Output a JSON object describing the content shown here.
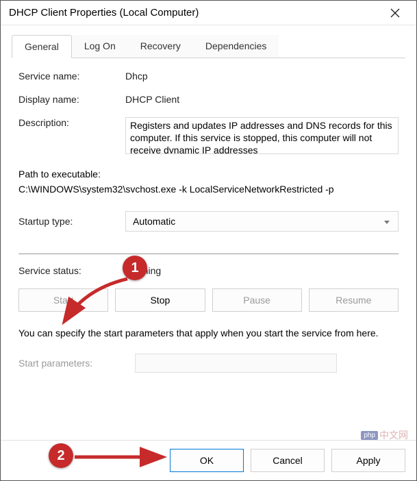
{
  "window": {
    "title": "DHCP Client Properties (Local Computer)"
  },
  "tabs": {
    "general": "General",
    "logon": "Log On",
    "recovery": "Recovery",
    "dependencies": "Dependencies"
  },
  "labels": {
    "service_name": "Service name:",
    "display_name": "Display name:",
    "description": "Description:",
    "path": "Path to executable:",
    "startup_type": "Startup type:",
    "service_status": "Service status:",
    "start_parameters": "Start parameters:"
  },
  "values": {
    "service_name": "Dhcp",
    "display_name": "DHCP Client",
    "description": "Registers and updates IP addresses and DNS records for this computer. If this service is stopped, this computer will not receive dynamic IP addresses",
    "path": "C:\\WINDOWS\\system32\\svchost.exe -k LocalServiceNetworkRestricted -p",
    "startup_type": "Automatic",
    "service_status": "Running"
  },
  "buttons": {
    "start": "Start",
    "stop": "Stop",
    "pause": "Pause",
    "resume": "Resume",
    "ok": "OK",
    "cancel": "Cancel",
    "apply": "Apply"
  },
  "hint": "You can specify the start parameters that apply when you start the service from here.",
  "watermark": "中文网",
  "annotations": {
    "step1": "1",
    "step2": "2"
  }
}
